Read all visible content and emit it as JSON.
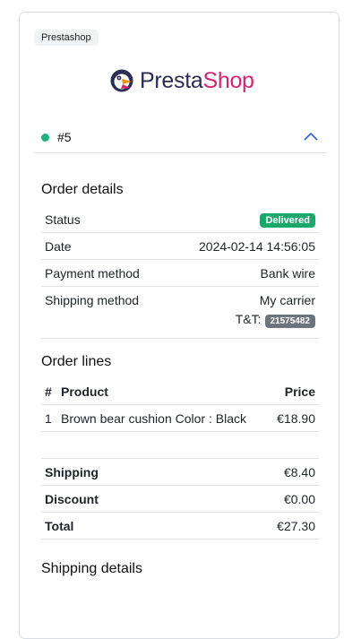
{
  "store_chip": "Prestashop",
  "logo": {
    "part1": "Presta",
    "part2": "Shop"
  },
  "order": {
    "number": "#5",
    "status_color": "#1bb37b"
  },
  "order_details": {
    "title": "Order details",
    "rows": [
      {
        "label": "Status",
        "value": "Delivered"
      },
      {
        "label": "Date",
        "value": "2024-02-14 14:56:05"
      },
      {
        "label": "Payment method",
        "value": "Bank wire"
      },
      {
        "label": "Shipping method",
        "value": "My carrier"
      }
    ],
    "tracking_label": "T&T:",
    "tracking_number": "21575482"
  },
  "order_lines": {
    "title": "Order lines",
    "headers": {
      "num": "#",
      "product": "Product",
      "price": "Price"
    },
    "items": [
      {
        "num": "1",
        "product": "Brown bear cushion Color : Black",
        "price": "€18.90"
      }
    ]
  },
  "totals": [
    {
      "label": "Shipping",
      "value": "€8.40"
    },
    {
      "label": "Discount",
      "value": "€0.00"
    },
    {
      "label": "Total",
      "value": "€27.30"
    }
  ],
  "shipping_details": {
    "title": "Shipping details"
  },
  "colors": {
    "accent": "#1bb37b",
    "badge_gray": "#6c757d",
    "link": "#2d5fd6"
  }
}
